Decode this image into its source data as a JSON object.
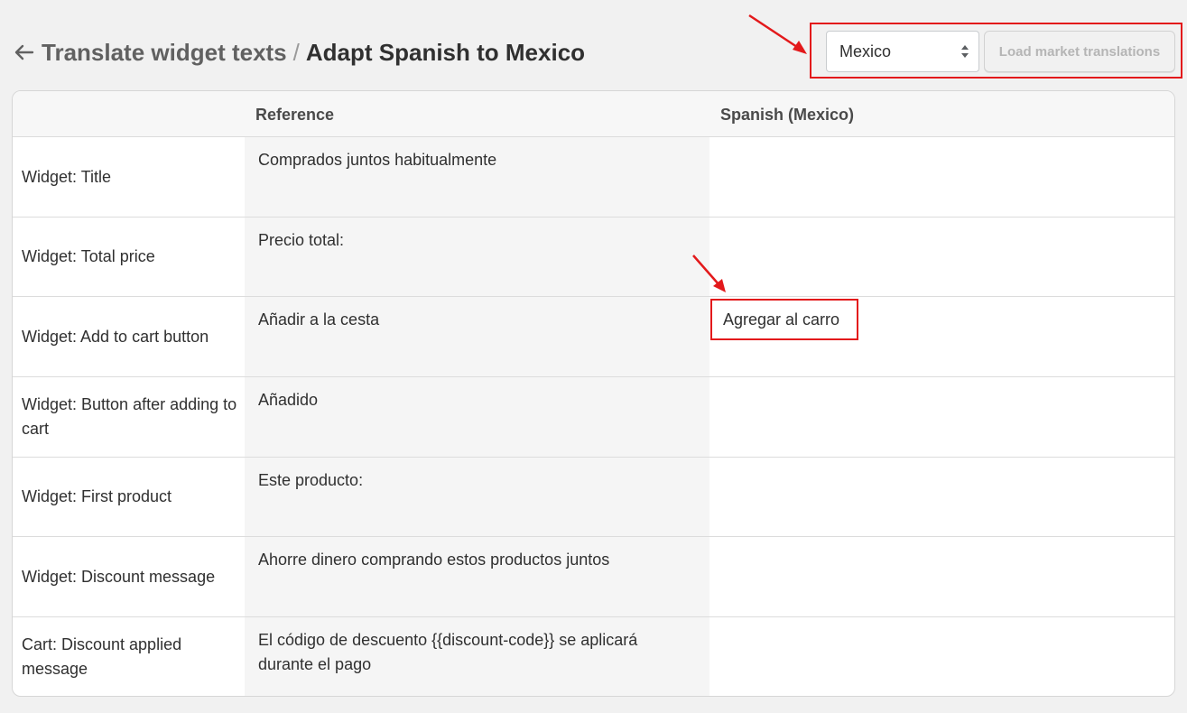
{
  "header": {
    "back_icon": "arrow-left-icon",
    "parent": "Translate widget texts",
    "separator": "/",
    "current": "Adapt Spanish to Mexico"
  },
  "controls": {
    "market_select_value": "Mexico",
    "load_button_label": "Load market translations"
  },
  "table": {
    "columns": [
      "",
      "Reference",
      "Spanish (Mexico)"
    ],
    "rows": [
      {
        "label": "Widget: Title",
        "reference": "Comprados juntos habitualmente",
        "translation": ""
      },
      {
        "label": "Widget: Total price",
        "reference": "Precio total:",
        "translation": ""
      },
      {
        "label": "Widget: Add to cart button",
        "reference": "Añadir a la cesta",
        "translation": "Agregar al carro"
      },
      {
        "label": "Widget: Button after adding to cart",
        "reference": "Añadido",
        "translation": ""
      },
      {
        "label": "Widget: First product",
        "reference": "Este producto:",
        "translation": ""
      },
      {
        "label": "Widget: Discount message",
        "reference": "Ahorre dinero comprando estos productos juntos",
        "translation": ""
      },
      {
        "label": "Cart: Discount applied message",
        "reference": "El código de descuento {{discount-code}} se aplicará durante el pago",
        "translation": ""
      }
    ]
  },
  "annotation_color": "#e3191b"
}
